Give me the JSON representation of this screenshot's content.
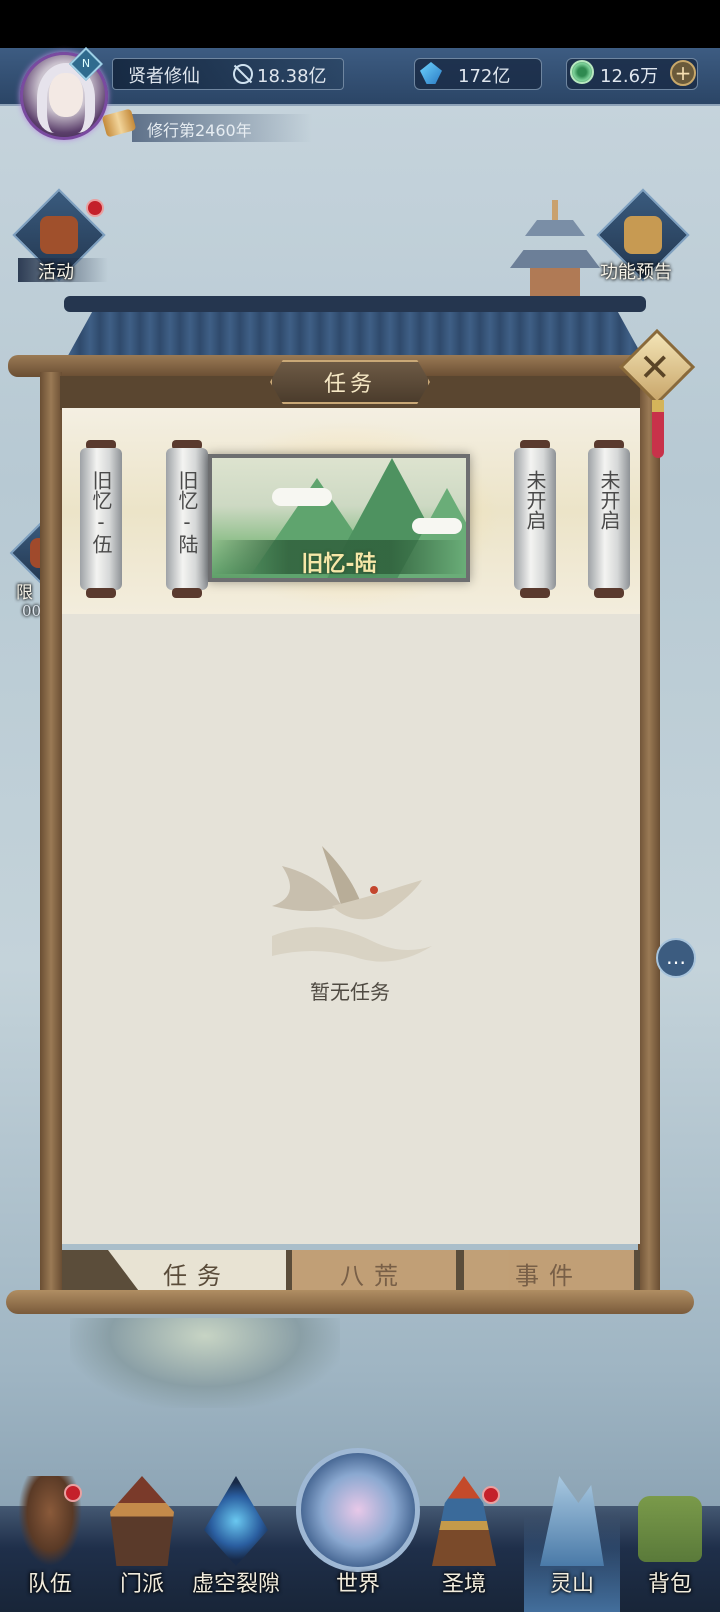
{
  "header": {
    "player_name": "贤者修仙",
    "power_value": "18.38亿",
    "currency1_value": "172亿",
    "currency2_value": "12.6万",
    "add_label": "+",
    "cultivation_text": "修行第2460年",
    "level_badge": "N"
  },
  "side_icons": {
    "activity_label": "活动",
    "preview_label": "功能预告",
    "limited_label": "限",
    "limited_timer": "00"
  },
  "modal": {
    "title": "任务",
    "close_label": "✕",
    "scrolls": [
      "旧忆-伍",
      "旧忆-陆",
      "未开启",
      "未开启"
    ],
    "selected_chapter": "旧忆-陆",
    "empty_text": "暂无任务",
    "tabs": [
      {
        "label": "任务",
        "active": true
      },
      {
        "label": "八荒",
        "active": false
      },
      {
        "label": "事件",
        "active": false
      }
    ]
  },
  "chat_icon": "…",
  "bottom_nav": [
    {
      "label": "队伍",
      "icon": "team-icon",
      "badge": true
    },
    {
      "label": "门派",
      "icon": "sect-icon",
      "badge": false
    },
    {
      "label": "虚空裂隙",
      "icon": "void-rift-icon",
      "badge": false
    },
    {
      "label": "世界",
      "icon": "world-icon",
      "badge": false
    },
    {
      "label": "圣境",
      "icon": "holy-realm-icon",
      "badge": true
    },
    {
      "label": "灵山",
      "icon": "spirit-mountain-icon",
      "badge": false,
      "selected": true
    },
    {
      "label": "背包",
      "icon": "backpack-icon",
      "badge": false
    }
  ],
  "colors": {
    "header_bg": "#2b4566",
    "panel_bg": "#e5e2d8",
    "frame_wood": "#9a7a55",
    "badge_red": "#c4202a",
    "title_gold": "#f5e7c4"
  }
}
